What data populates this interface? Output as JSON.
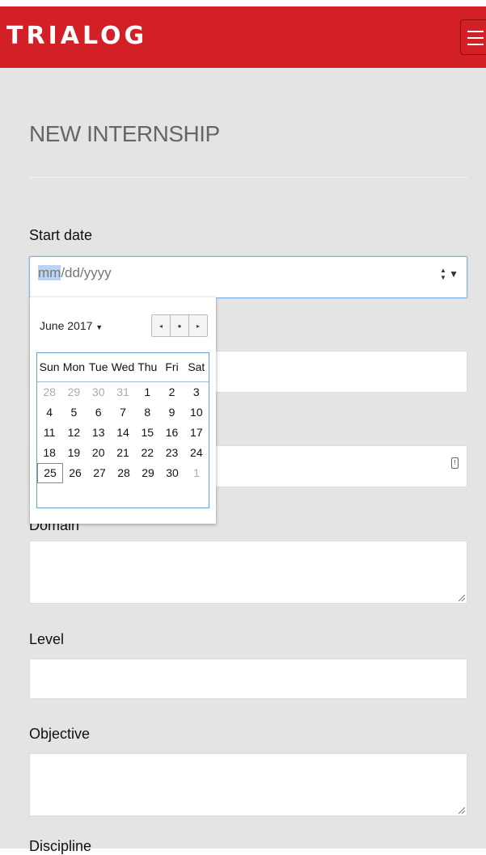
{
  "app": {
    "brand": "TRIALOG"
  },
  "page": {
    "title": "NEW INTERNSHIP"
  },
  "form": {
    "start_date": {
      "label": "Start date",
      "placeholder_highlight": "mm",
      "placeholder_rest": "/dd/yyyy"
    },
    "domain": {
      "label": "Domain"
    },
    "level": {
      "label": "Level"
    },
    "objective": {
      "label": "Objective"
    },
    "discipline": {
      "label": "Discipline"
    }
  },
  "calendar": {
    "month_label": "June 2017",
    "weekdays": [
      "Sun",
      "Mon",
      "Tue",
      "Wed",
      "Thu",
      "Fri",
      "Sat"
    ],
    "weeks": [
      [
        "28",
        "29",
        "30",
        "31",
        "1",
        "2",
        "3"
      ],
      [
        "4",
        "5",
        "6",
        "7",
        "8",
        "9",
        "10"
      ],
      [
        "11",
        "12",
        "13",
        "14",
        "15",
        "16",
        "17"
      ],
      [
        "18",
        "19",
        "20",
        "21",
        "22",
        "23",
        "24"
      ],
      [
        "25",
        "26",
        "27",
        "28",
        "29",
        "30",
        "1"
      ]
    ],
    "other_month": [
      [
        true,
        true,
        true,
        true,
        false,
        false,
        false
      ],
      [
        false,
        false,
        false,
        false,
        false,
        false,
        false
      ],
      [
        false,
        false,
        false,
        false,
        false,
        false,
        false
      ],
      [
        false,
        false,
        false,
        false,
        false,
        false,
        false
      ],
      [
        false,
        false,
        false,
        false,
        false,
        false,
        true
      ]
    ],
    "today": "25"
  },
  "icons": {
    "menu": "hamburger-icon",
    "prev": "chevron-left-icon",
    "today": "dot-icon",
    "next": "chevron-right-icon",
    "dropdown": "caret-down-icon"
  },
  "colors": {
    "navbar": "#d32027",
    "background": "#e4e4e4",
    "focus_border": "#7fb3e8",
    "calendar_border": "#6a9fe0"
  }
}
